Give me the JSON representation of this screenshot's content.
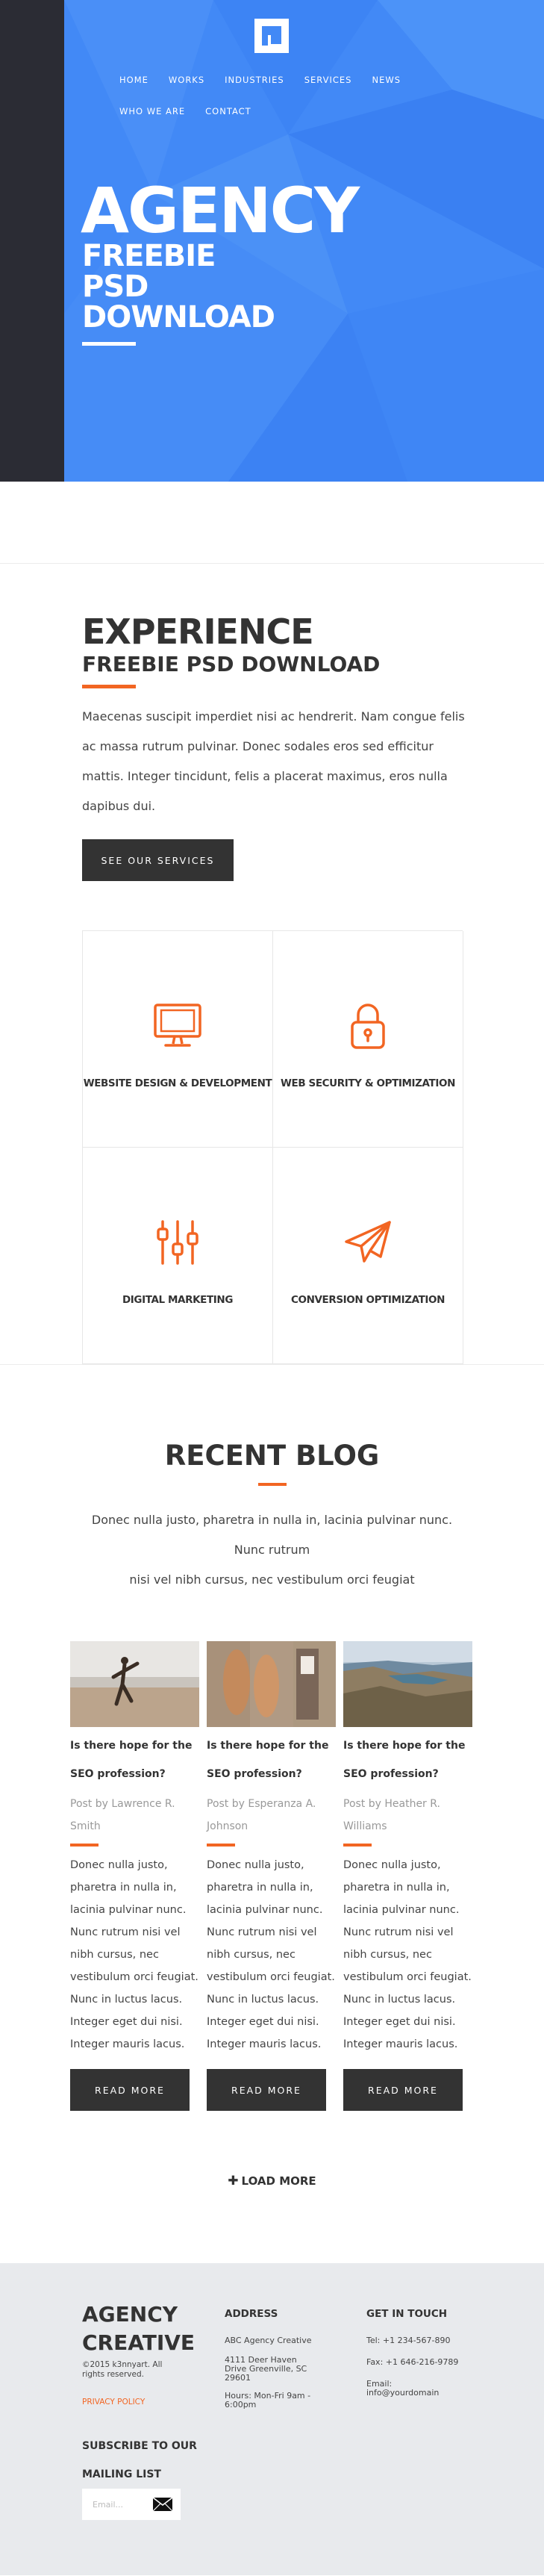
{
  "nav": {
    "items": [
      "HOME",
      "WORKS",
      "INDUSTRIES",
      "SERVICES",
      "NEWS",
      "WHO WE ARE",
      "CONTACT"
    ]
  },
  "hero": {
    "title": "AGENCY",
    "subtitle_lines": [
      "FREEBIE",
      "PSD",
      "DOWNLOAD"
    ]
  },
  "experience": {
    "title": "EXPERIENCE",
    "subtitle": "FREEBIE PSD DOWNLOAD",
    "body": "Maecenas suscipit imperdiet nisi ac hendrerit. Nam congue felis ac massa rutrum pulvinar. Donec sodales eros sed efficitur mattis. Integer tincidunt, felis a placerat maximus, eros nulla dapibus dui.",
    "button": "SEE OUR SERVICES"
  },
  "services": [
    {
      "label": "WEBSITE DESIGN & DEVELOPMENT",
      "icon": "monitor-icon"
    },
    {
      "label": "WEB SECURITY & OPTIMIZATION",
      "icon": "padlock-icon"
    },
    {
      "label": "DIGITAL MARKETING",
      "icon": "sliders-icon"
    },
    {
      "label": "CONVERSION OPTIMIZATION",
      "icon": "paper-plane-icon"
    }
  ],
  "blog": {
    "title": "RECENT BLOG",
    "intro_line1": "Donec nulla justo, pharetra in nulla in, lacinia pulvinar nunc. Nunc rutrum",
    "intro_line2": "nisi vel nibh cursus, nec vestibulum orci feugiat",
    "posts": [
      {
        "title": "Is there hope for the SEO profession?",
        "meta": "Post by Lawrence R. Smith",
        "excerpt": "Donec nulla justo, pharetra in nulla in, lacinia pulvinar nunc. Nunc rutrum nisi vel nibh cursus, nec vestibulum orci feugiat. Nunc in luctus lacus. Integer eget dui nisi. Integer mauris lacus.",
        "button": "READ MORE"
      },
      {
        "title": "Is there hope for the SEO profession?",
        "meta": "Post by Esperanza A. Johnson",
        "excerpt": "Donec nulla justo, pharetra in nulla in, lacinia pulvinar nunc. Nunc rutrum nisi vel nibh cursus, nec vestibulum orci feugiat. Nunc in luctus lacus. Integer eget dui nisi. Integer mauris lacus.",
        "button": "READ MORE"
      },
      {
        "title": "Is there hope for the SEO profession?",
        "meta": "Post by Heather R. Williams",
        "excerpt": "Donec nulla justo, pharetra in nulla in, lacinia pulvinar nunc. Nunc rutrum nisi vel nibh cursus, nec vestibulum orci feugiat. Nunc in luctus lacus. Integer eget dui nisi. Integer mauris lacus.",
        "button": "READ MORE"
      }
    ],
    "load_more": "LOAD MORE"
  },
  "footer": {
    "brand_line1": "AGENCY",
    "brand_line2": "CREATIVE",
    "copyright": "©2015 k3nnyart. All rights reserved.",
    "privacy": "PRIVACY POLICY",
    "subscribe_title": "SUBSCRIBE TO OUR MAILING LIST",
    "subscribe_placeholder": "Email...",
    "address": {
      "title": "ADDRESS",
      "company": "ABC Agency Creative",
      "street1": "4111 Deer Haven",
      "street2": "Drive Greenville, SC",
      "zip": "29601",
      "hours1": "Hours: Mon-Fri 9am -",
      "hours2": "6:00pm"
    },
    "contact": {
      "title": "GET IN TOUCH",
      "tel": "Tel: +1 234-567-890",
      "fax": "Fax: +1 646-216-9789",
      "email_label": "Email:",
      "email": "info@yourdomain"
    }
  },
  "colors": {
    "hero_blue": "#4289f6",
    "sidebar_dark": "#2b2c34",
    "accent_orange": "#f26522",
    "button_dark": "#333333",
    "footer_bg": "#e8eaed"
  }
}
